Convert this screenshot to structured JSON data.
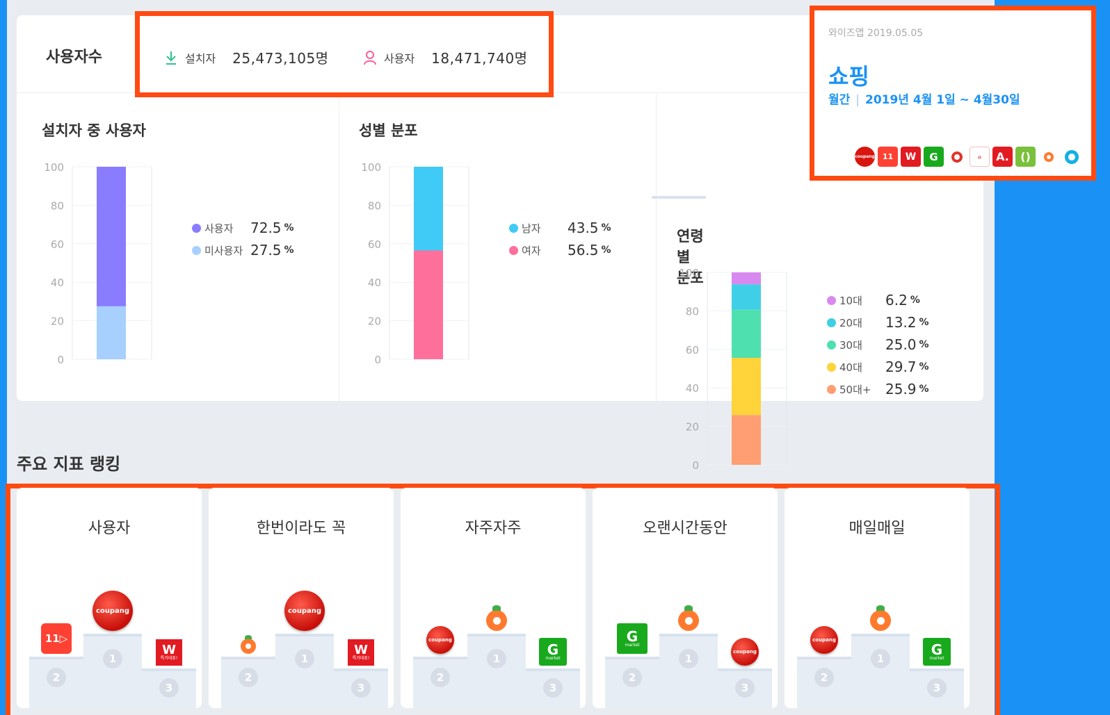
{
  "users": {
    "title": "사용자수",
    "install_label": "설치자",
    "install_value": "25,473,105명",
    "user_label": "사용자",
    "user_value": "18,471,740명"
  },
  "info": {
    "source": "와이즈앱 2019.05.05",
    "category": "쇼핑",
    "period_type": "월간",
    "period_range": "2019년 4월 1일 ~ 4월30일"
  },
  "charts": {
    "usage": {
      "title": "설치자 중 사용자",
      "legend": [
        {
          "name": "사용자",
          "pct": "72.5",
          "unit": "%",
          "color": "#8a7cff"
        },
        {
          "name": "미사용자",
          "pct": "27.5",
          "unit": "%",
          "color": "#a8d0ff"
        }
      ]
    },
    "gender": {
      "title": "성별 분포",
      "legend": [
        {
          "name": "남자",
          "pct": "43.5",
          "unit": "%",
          "color": "#3fcbf5"
        },
        {
          "name": "여자",
          "pct": "56.5",
          "unit": "%",
          "color": "#ff6f9c"
        }
      ]
    },
    "age": {
      "title": "연령별 분포",
      "legend": [
        {
          "name": "10대",
          "pct": "6.2",
          "unit": "%",
          "color": "#d889f0"
        },
        {
          "name": "20대",
          "pct": "13.2",
          "unit": "%",
          "color": "#3fcfe6"
        },
        {
          "name": "30대",
          "pct": "25.0",
          "unit": "%",
          "color": "#4fe0b0"
        },
        {
          "name": "40대",
          "pct": "29.7",
          "unit": "%",
          "color": "#ffd33a"
        },
        {
          "name": "50대+",
          "pct": "25.9",
          "unit": "%",
          "color": "#ff9e72"
        }
      ]
    }
  },
  "chart_data": [
    {
      "type": "bar",
      "categories": [
        "사용자",
        "미사용자"
      ],
      "values": [
        72.5,
        27.5
      ],
      "title": "설치자 중 사용자",
      "ylim": [
        0,
        100
      ],
      "yticks": [
        "100",
        "80",
        "60",
        "40",
        "20",
        "0"
      ]
    },
    {
      "type": "bar",
      "categories": [
        "남자",
        "여자"
      ],
      "values": [
        43.5,
        56.5
      ],
      "title": "성별 분포",
      "ylim": [
        0,
        100
      ],
      "yticks": [
        "100",
        "80",
        "60",
        "40",
        "20",
        "0"
      ]
    },
    {
      "type": "bar",
      "categories": [
        "10대",
        "20대",
        "30대",
        "40대",
        "50대+"
      ],
      "values": [
        6.2,
        13.2,
        25.0,
        29.7,
        25.9
      ],
      "title": "연령별 분포",
      "ylim": [
        0,
        100
      ],
      "yticks": [
        "100",
        "80",
        "60",
        "40",
        "20",
        "0"
      ]
    }
  ],
  "ranking": {
    "section_title": "주요 지표 랭킹",
    "cards": [
      {
        "title": "사용자",
        "first": "coupang",
        "second": "11st",
        "third": "wemakeprice"
      },
      {
        "title": "한번이라도 꼭",
        "first": "coupang",
        "second": "carrot",
        "third": "wemakeprice"
      },
      {
        "title": "자주자주",
        "first": "carrot",
        "second": "coupang",
        "third": "gmarket"
      },
      {
        "title": "오랜시간동안",
        "first": "carrot",
        "second": "gmarket",
        "third": "coupang"
      },
      {
        "title": "매일매일",
        "first": "carrot",
        "second": "coupang",
        "third": "gmarket"
      }
    ],
    "podium_numbers": [
      "1",
      "2",
      "3"
    ]
  },
  "logos": {
    "coupang": "coupang",
    "e11": "11",
    "wmp": "W",
    "wmp_sub": "특가대표!",
    "gm": "G",
    "gm_sub": "market"
  }
}
